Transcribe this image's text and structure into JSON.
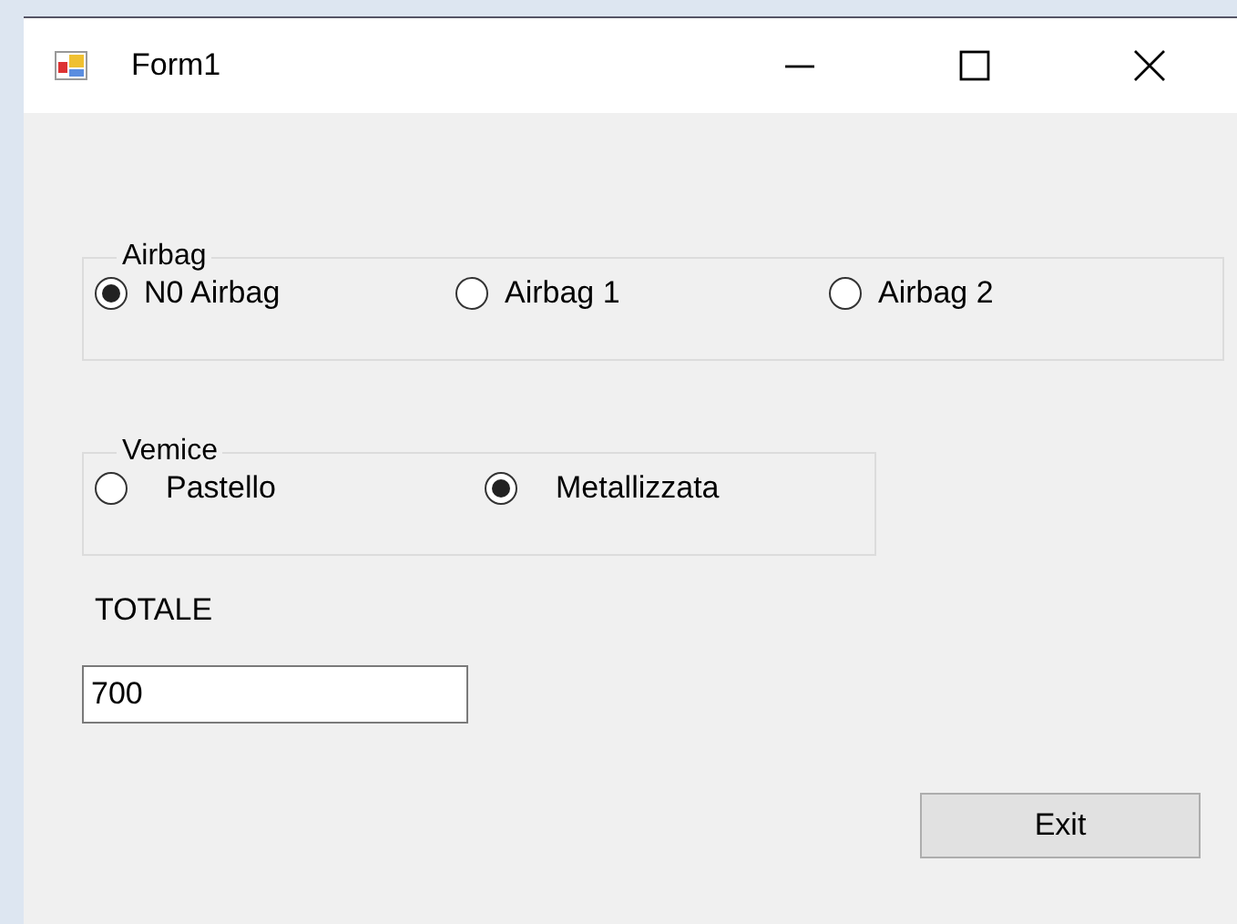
{
  "window": {
    "title": "Form1"
  },
  "groups": [
    {
      "title": "Airbag",
      "options": [
        {
          "label": "N0 Airbag",
          "selected": true
        },
        {
          "label": "Airbag 1",
          "selected": false
        },
        {
          "label": "Airbag 2",
          "selected": false
        }
      ]
    },
    {
      "title": "Vemice",
      "options": [
        {
          "label": "Pastello",
          "selected": false
        },
        {
          "label": "Metallizzata",
          "selected": true
        }
      ]
    }
  ],
  "total": {
    "label": "TOTALE",
    "value": "700"
  },
  "buttons": [
    "Exit"
  ]
}
